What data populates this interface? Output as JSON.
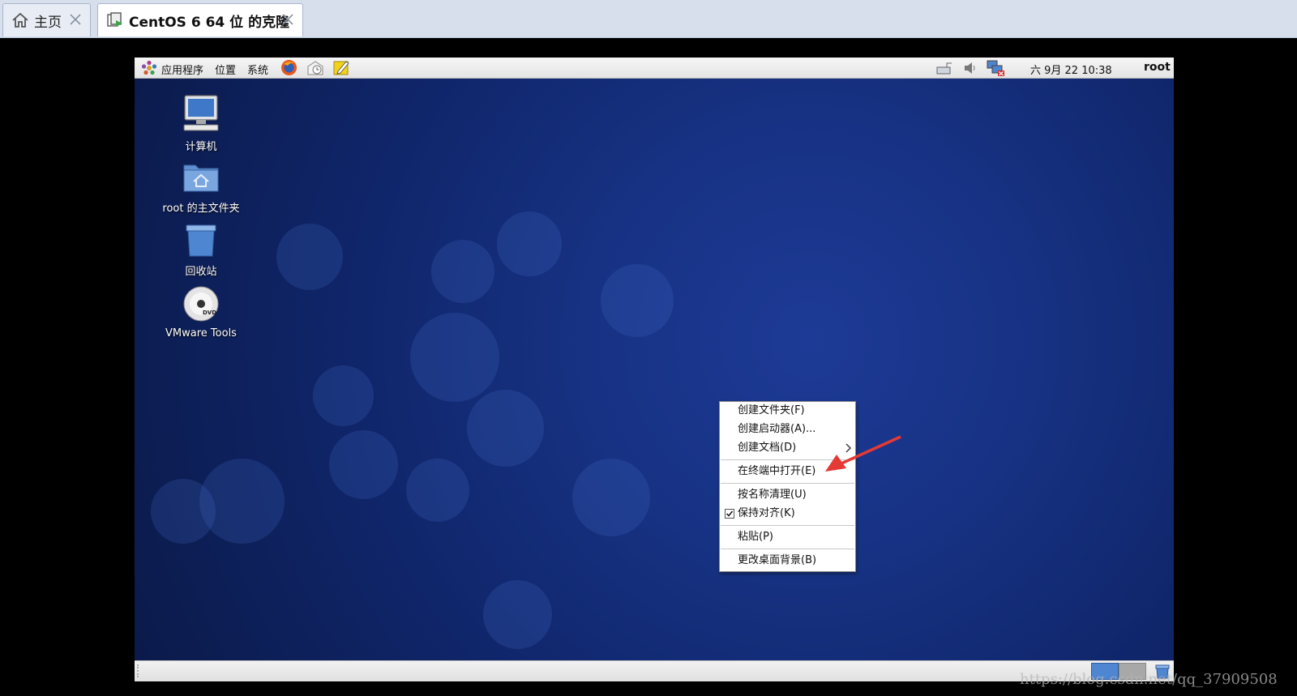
{
  "host_tabs": [
    {
      "label": "主页",
      "icon": "home-icon",
      "active": false
    },
    {
      "label": "CentOS 6 64 位 的克隆",
      "icon": "vm-icon",
      "active": true
    }
  ],
  "top_panel": {
    "menus": [
      "应用程序",
      "位置",
      "系统"
    ],
    "clock": "六 9月 22 10:38",
    "user": "root"
  },
  "desktop_icons": [
    {
      "label": "计算机",
      "icon": "computer-icon"
    },
    {
      "label": "root 的主文件夹",
      "icon": "home-folder-icon"
    },
    {
      "label": "回收站",
      "icon": "trash-icon"
    },
    {
      "label": "VMware Tools",
      "icon": "dvd-icon"
    }
  ],
  "context_menu": {
    "items": [
      {
        "label": "创建文件夹(F)"
      },
      {
        "label": "创建启动器(A)..."
      },
      {
        "label": "创建文档(D)",
        "submenu": true
      },
      {
        "label": "在终端中打开(E)"
      },
      {
        "label": "按名称清理(U)"
      },
      {
        "label": "保持对齐(K)",
        "checked": true
      },
      {
        "label": "粘贴(P)"
      },
      {
        "label": "更改桌面背景(B)"
      }
    ]
  },
  "watermark": "https://blog.csdn.net/qq_37909508",
  "colors": {
    "arrow": "#e53935",
    "desktop": "#132a78"
  }
}
